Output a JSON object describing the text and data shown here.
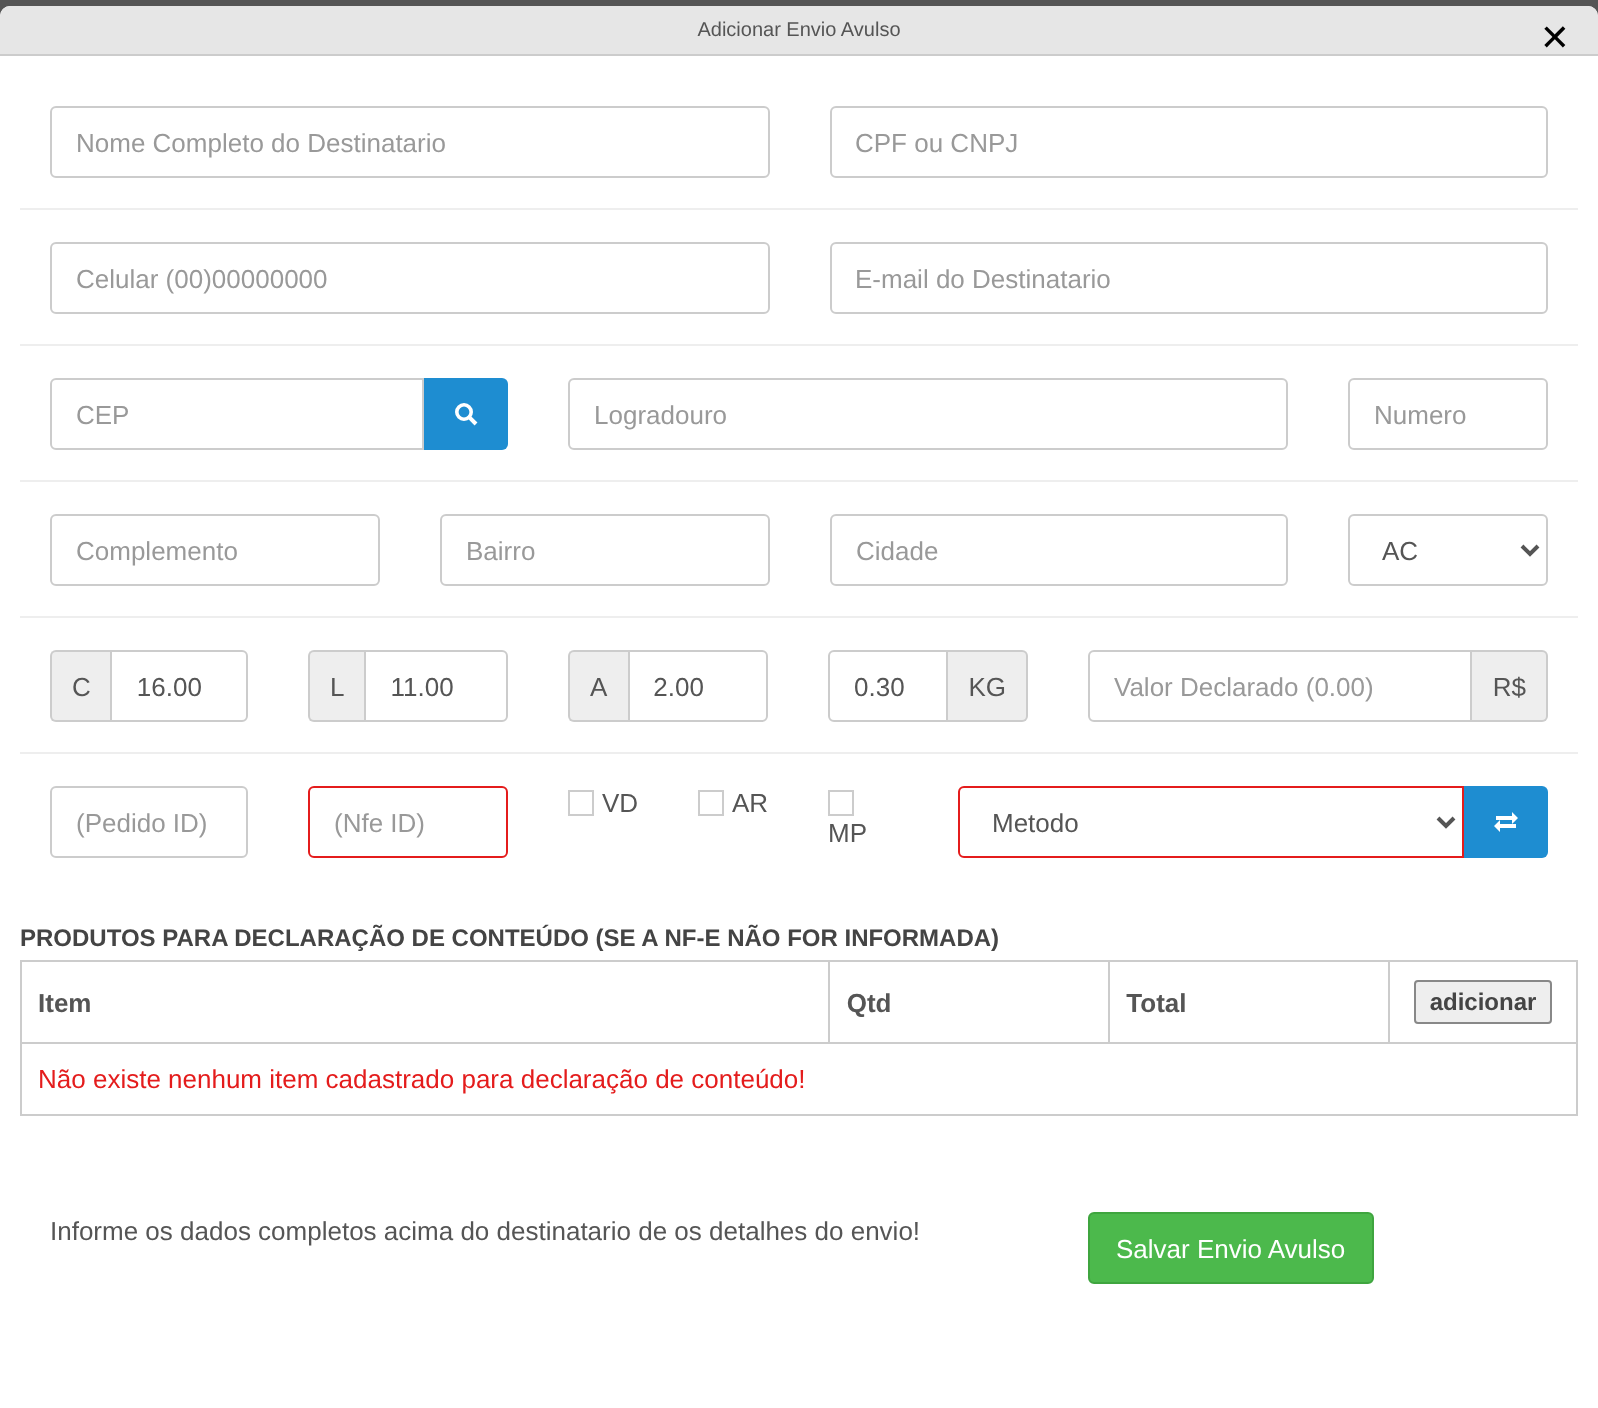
{
  "window": {
    "title": "Adicionar Envio Avulso",
    "close": "✕"
  },
  "form_rows": [
    [
      {
        "kind": "input",
        "placeholder": "Nome Completo do Destinatario"
      },
      {
        "kind": "input",
        "placeholder": "CPF ou CNPJ"
      }
    ],
    [
      {
        "kind": "input",
        "placeholder": "Celular (00)00000000"
      },
      {
        "kind": "input",
        "placeholder": "E-mail do Destinatario"
      }
    ],
    [
      {
        "kind": "search-input",
        "placeholder": "CEP"
      },
      {
        "kind": "input",
        "placeholder": "Logradouro"
      },
      {
        "kind": "input",
        "placeholder": "Numero"
      }
    ],
    [
      {
        "kind": "input",
        "placeholder": "Complemento"
      },
      {
        "kind": "input",
        "placeholder": "Bairro"
      },
      {
        "kind": "input",
        "placeholder": "Cidade"
      },
      {
        "kind": "select",
        "value": "AC"
      }
    ],
    [
      {
        "kind": "prefix-input",
        "addon": "C",
        "value": "16.00"
      },
      {
        "kind": "prefix-input",
        "addon": "L",
        "value": "11.00"
      },
      {
        "kind": "prefix-input",
        "addon": "A",
        "value": "2.00"
      },
      {
        "kind": "suffix-input",
        "addon": "KG",
        "value": "0.30"
      },
      {
        "kind": "suffix-input",
        "addon": "R$",
        "placeholder": "Valor Declarado (0.00)"
      }
    ],
    [
      {
        "kind": "input",
        "placeholder": "(Pedido ID)",
        "invalid": false
      },
      {
        "kind": "input",
        "placeholder": "(Nfe ID)",
        "invalid": true
      },
      {
        "kind": "checkbox",
        "label": "VD",
        "checked": false
      },
      {
        "kind": "checkbox",
        "label": "AR",
        "checked": false
      },
      {
        "kind": "checkbox",
        "label": "MP",
        "checked": false
      },
      {
        "kind": "select-button",
        "value": "Metodo",
        "invalid": true
      }
    ]
  ],
  "products": {
    "heading": "PRODUTOS PARA DECLARAÇÃO DE CONTEÚDO (SE A NF-E NÃO FOR INFORMADA)",
    "columns": [
      "Item",
      "Qtd",
      "Total"
    ],
    "add_button": "adicionar",
    "empty_message": "Não existe nenhum item cadastrado para declaração de conteúdo!"
  },
  "footer": {
    "message": "Informe os dados completos acima do destinatario de os detalhes do envio!",
    "save_button": "Salvar Envio Avulso"
  }
}
